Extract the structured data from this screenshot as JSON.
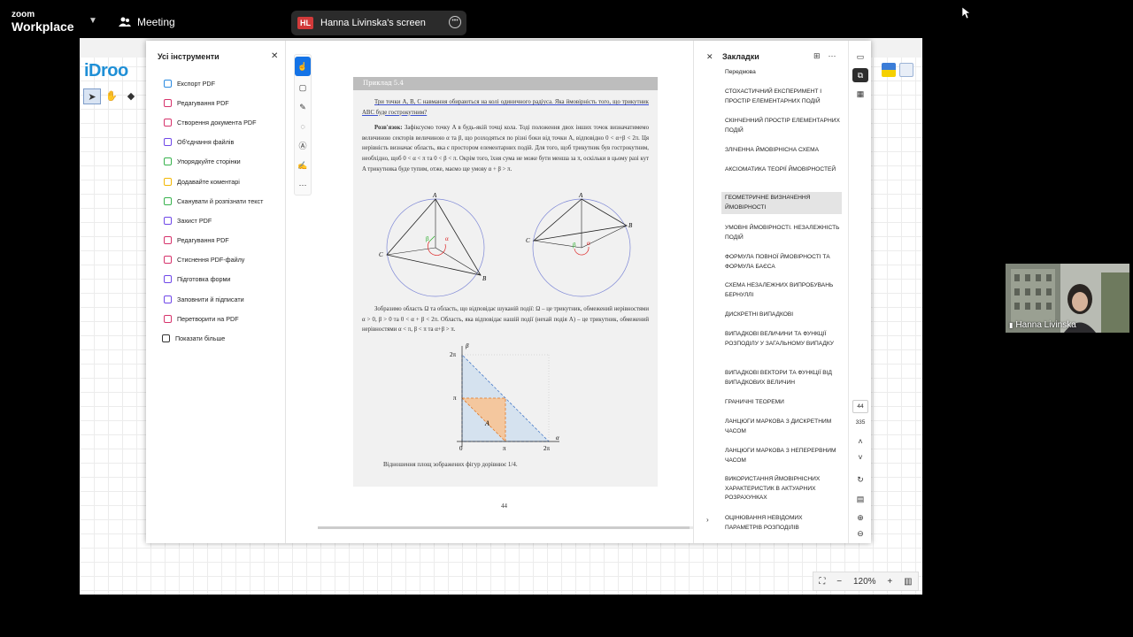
{
  "zoom": {
    "brand_top": "zoom",
    "brand_bottom": "Workplace",
    "meeting_label": "Meeting",
    "share_badge": "HL",
    "share_label": "Hanna Livinska's screen",
    "participant_name": "Hanna Livinska"
  },
  "idroo": {
    "logo": "iDroo",
    "zoom_level": "120%"
  },
  "tools_panel": {
    "title": "Усі інструменти",
    "items": [
      {
        "label": "Експорт PDF",
        "icon": "export-pdf-icon",
        "color": "#2b8ae0"
      },
      {
        "label": "Редагування PDF",
        "icon": "edit-pdf-icon",
        "color": "#d6336c"
      },
      {
        "label": "Створення документа PDF",
        "icon": "create-pdf-icon",
        "color": "#d6336c"
      },
      {
        "label": "Об'єднання файлів",
        "icon": "combine-files-icon",
        "color": "#7048e8"
      },
      {
        "label": "Упорядкуйте сторінки",
        "icon": "organize-pages-icon",
        "color": "#37b24d"
      },
      {
        "label": "Додавайте коментарі",
        "icon": "comment-icon",
        "color": "#f2b705"
      },
      {
        "label": "Сканувати й розпізнати текст",
        "icon": "scan-ocr-icon",
        "color": "#37b24d"
      },
      {
        "label": "Захист PDF",
        "icon": "protect-pdf-icon",
        "color": "#7048e8"
      },
      {
        "label": "Редагування PDF",
        "icon": "redact-pdf-icon",
        "color": "#d6336c"
      },
      {
        "label": "Стиснення PDF-файлу",
        "icon": "compress-pdf-icon",
        "color": "#d6336c"
      },
      {
        "label": "Підготовка форми",
        "icon": "prepare-form-icon",
        "color": "#7048e8"
      },
      {
        "label": "Заповнити й підписати",
        "icon": "fill-sign-icon",
        "color": "#7048e8"
      },
      {
        "label": "Перетворити на PDF",
        "icon": "convert-pdf-icon",
        "color": "#d6336c"
      },
      {
        "label": "Показати більше",
        "icon": "show-more-icon",
        "color": "#333333"
      }
    ]
  },
  "document": {
    "example_header": "Приклад 5.4",
    "problem": "Три точки A, B, C навмання обираються на колі одиничного радіуса. Яка ймовірність того, що трикутник ABC буде гострокутним?",
    "solution_label": "Розв'язок:",
    "solution": "Зафіксуємо точку A в будь-якій точці кола. Тоді положення двох інших точок визначатимемо величиною секторів величиною α та β, що розходяться по різні боки від точки A, відповідно 0 < α+β < 2π. Ця нерівність визначає область, яка є простором елементарних подій. Для того, щоб трикутник був гострокутним, необхідно, щоб 0 < α < π та 0 < β < π. Окрім того, їхня сума не може бути менша за π, оскільки в цьому разі кут A трикутника буде тупим, отже, маємо ще умову α + β > π.",
    "paragraph3": "Зобразимо область Ω та область, що відповідає шуканій події: Ω – це трикутник, обмежений нерівностями α > 0, β > 0 та 0 < α + β < 2π. Область, яка відповідає нашій події (нехай подія A) – це трикутник, обмежений нерівностями α < π, β < π та α+β > π.",
    "caption": "Відношення площ зображених фігур дорівнює 1/4.",
    "page_number": "44",
    "figure_labels": {
      "A": "A",
      "B": "B",
      "C": "C",
      "alpha": "α",
      "beta": "β",
      "two_pi": "2π",
      "pi": "π",
      "zero": "0",
      "region_A": "A"
    }
  },
  "bookmarks": {
    "title": "Закладки",
    "items": [
      "Передмова",
      "СТОХАСТИЧНИЙ ЕКСПЕРИМЕНТ І ПРОСТІР ЕЛЕМЕНТАРНИХ ПОДІЙ",
      "СКІНЧЕННИЙ ПРОСТІР ЕЛЕМЕНТАРНИХ ПОДІЙ",
      "ЗЛІЧЕННА ЙМОВІРНІСНА СХЕМА",
      "АКСІОМАТИКА ТЕОРІЇ ЙМОВІРНОСТЕЙ",
      "ГЕОМЕТРИЧНЕ ВИЗНАЧЕННЯ ЙМОВІРНОСТІ",
      "УМОВНІ ЙМОВІРНОСТІ. НЕЗАЛЕЖНІСТЬ ПОДІЙ",
      "ФОРМУЛА ПОВНОЇ ЙМОВІРНОСТІ ТА ФОРМУЛА БАЄСА",
      "СХЕМА НЕЗАЛЕЖНИХ ВИПРОБУВАНЬ БЕРНУЛЛІ",
      "ДИСКРЕТНІ ВИПАДКОВІ",
      "ВИПАДКОВІ ВЕЛИЧИНИ ТА ФУНКЦІЇ РОЗПОДІЛУ У ЗАГАЛЬНОМУ ВИПАДКУ",
      "ВИПАДКОВІ ВЕКТОРИ ТА ФУНКЦІЇ ВІД ВИПАДКОВИХ ВЕЛИЧИН",
      "ГРАНИЧНІ ТЕОРЕМИ",
      "ЛАНЦЮГИ МАРКОВА З ДИСКРЕТНИМ ЧАСОМ",
      "ЛАНЦЮГИ МАРКОВА З НЕПЕРЕРВНИМ ЧАСОМ",
      "ВИКОРИСТАННЯ ЙМОВІРНІСНИХ ХАРАКТЕРИСТИК В АКТУАРНИХ РОЗРАХУНКАХ",
      "ОЦІНЮВАННЯ НЕВІДОМИХ ПАРАМЕТРІВ РОЗПОДІЛІВ"
    ],
    "selected_index": 5
  },
  "page_nav": {
    "current": "44",
    "total": "335"
  }
}
